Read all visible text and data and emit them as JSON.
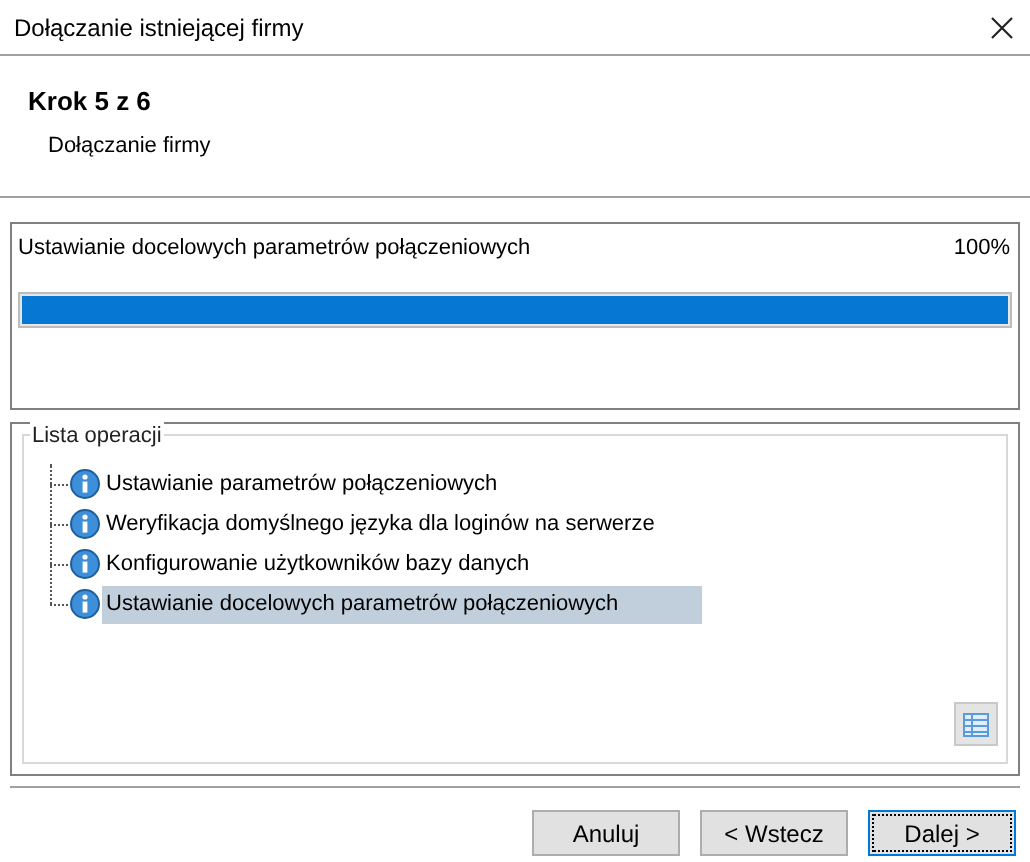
{
  "window": {
    "title": "Dołączanie istniejącej firmy"
  },
  "header": {
    "step": "Krok 5 z 6",
    "subtitle": "Dołączanie firmy"
  },
  "progress": {
    "label": "Ustawianie docelowych parametrów połączeniowych",
    "percent": "100%",
    "level": 1
  },
  "operations": {
    "title": "Lista operacji",
    "items": [
      {
        "label": "Ustawianie parametrów połączeniowych",
        "selected": false
      },
      {
        "label": "Weryfikacja domyślnego języka dla loginów na serwerze",
        "selected": false
      },
      {
        "label": "Konfigurowanie użytkowników bazy danych",
        "selected": false
      },
      {
        "label": "Ustawianie docelowych parametrów połączeniowych",
        "selected": true
      }
    ]
  },
  "buttons": [
    {
      "label": "Anuluj",
      "focused": false
    },
    {
      "label": "< Wstecz",
      "focused": false
    },
    {
      "label": "Dalej >",
      "focused": true
    }
  ]
}
